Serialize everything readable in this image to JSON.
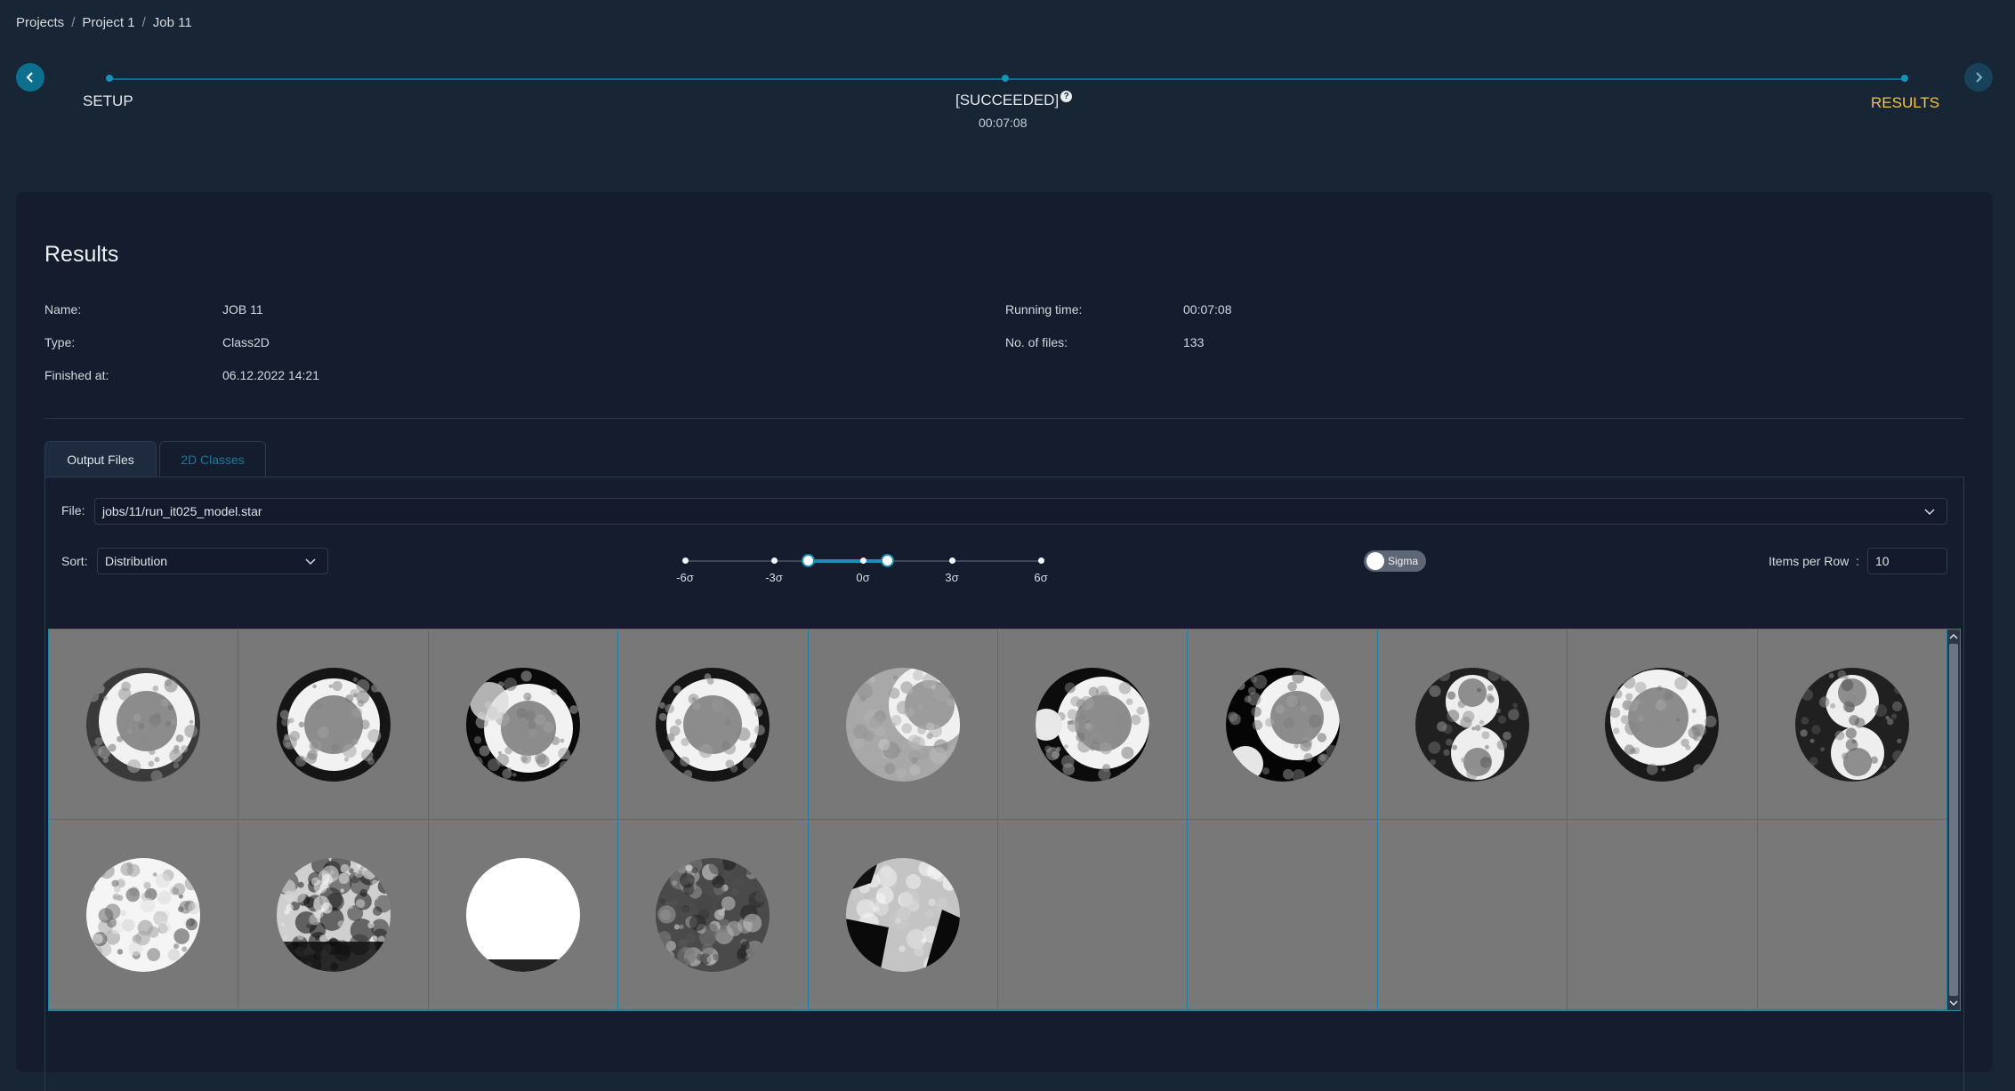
{
  "breadcrumb": [
    "Projects",
    "Project 1",
    "Job 11"
  ],
  "stepper": {
    "setup_label": "SETUP",
    "status_label": "[SUCCEEDED]",
    "status_time": "00:07:08",
    "results_label": "RESULTS"
  },
  "results": {
    "title": "Results",
    "fields": {
      "name_label": "Name:",
      "name_value": "JOB 11",
      "type_label": "Type:",
      "type_value": "Class2D",
      "finished_label": "Finished at:",
      "finished_value": "06.12.2022 14:21",
      "running_label": "Running time:",
      "running_value": "00:07:08",
      "files_label": "No. of files:",
      "files_value": "133"
    }
  },
  "tabs": [
    "Output Files",
    "2D Classes"
  ],
  "controls": {
    "file_label": "File",
    "file_value": "jobs/11/run_it025_model.star",
    "sort_label": "Sort",
    "sort_value": "Distribution",
    "sigma_ticks": [
      "-6σ",
      "-3σ",
      "0σ",
      "3σ",
      "6σ"
    ],
    "sigma_range": [
      -1.5,
      1.5
    ],
    "sigma_toggle_label": "Sigma",
    "sigma_toggle_on": false,
    "items_label": "Items per Row",
    "items_value": "10"
  },
  "grid": {
    "columns": 10,
    "rows": 2,
    "classes": [
      {
        "type": "ring-offset"
      },
      {
        "type": "ring"
      },
      {
        "type": "ring-bright"
      },
      {
        "type": "ring"
      },
      {
        "type": "arc"
      },
      {
        "type": "ring-left"
      },
      {
        "type": "ring-dark"
      },
      {
        "type": "twin"
      },
      {
        "type": "ring-top"
      },
      {
        "type": "twin"
      },
      {
        "type": "noisy-white"
      },
      {
        "type": "noisy-dark"
      },
      {
        "type": "white"
      },
      {
        "type": "blotchy"
      },
      {
        "type": "noisy-mixed"
      },
      {
        "type": "empty"
      },
      {
        "type": "empty"
      },
      {
        "type": "empty"
      },
      {
        "type": "empty"
      },
      {
        "type": "empty"
      }
    ]
  },
  "colors": {
    "accent": "#1a8fb1",
    "results_active": "#f2c44d",
    "background": "#172535",
    "panel": "#151c2e"
  }
}
